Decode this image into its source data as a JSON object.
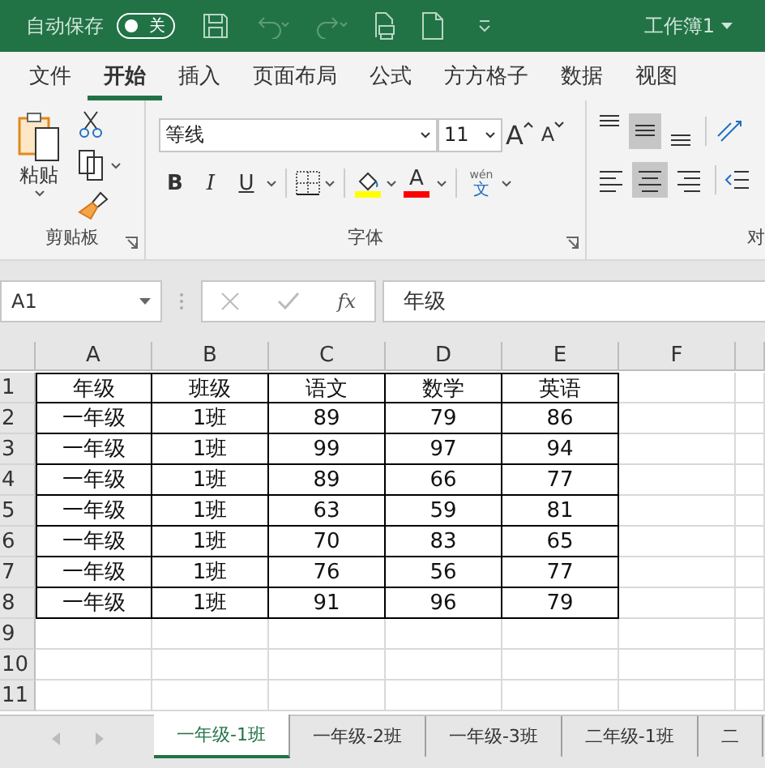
{
  "title_bar": {
    "autosave_label": "自动保存",
    "autosave_toggle": {
      "label": "关",
      "on": false
    },
    "workbook": "工作簿1"
  },
  "menu_tabs": [
    {
      "label": "文件",
      "selected": false
    },
    {
      "label": "开始",
      "selected": true
    },
    {
      "label": "插入",
      "selected": false
    },
    {
      "label": "页面布局",
      "selected": false
    },
    {
      "label": "公式",
      "selected": false
    },
    {
      "label": "方方格子",
      "selected": false
    },
    {
      "label": "数据",
      "selected": false
    },
    {
      "label": "视图",
      "selected": false
    }
  ],
  "ribbon": {
    "clipboard": {
      "label": "剪贴板",
      "paste": "粘贴"
    },
    "font": {
      "label": "字体",
      "name": "等线",
      "size": "11",
      "grow": "A",
      "shrink": "A",
      "bold": "B",
      "italic": "I",
      "underline": "U",
      "font_color": "A",
      "phonetic_top": "wén",
      "phonetic_bottom": "文"
    },
    "alignment": {
      "label": "对",
      "vertical": [
        {
          "selected": false
        },
        {
          "selected": true
        },
        {
          "selected": false
        }
      ],
      "horizontal": [
        {
          "selected": false
        },
        {
          "selected": true
        },
        {
          "selected": false
        }
      ]
    }
  },
  "formula_bar": {
    "name_box": "A1",
    "fx": "fx",
    "value": "年级"
  },
  "sheet": {
    "columns": [
      "A",
      "B",
      "C",
      "D",
      "E",
      "F"
    ],
    "rows": [
      {
        "header": "1",
        "cells": [
          "年级",
          "班级",
          "语文",
          "数学",
          "英语"
        ]
      },
      {
        "header": "2",
        "cells": [
          "一年级",
          "1班",
          "89",
          "79",
          "86"
        ]
      },
      {
        "header": "3",
        "cells": [
          "一年级",
          "1班",
          "99",
          "97",
          "94"
        ]
      },
      {
        "header": "4",
        "cells": [
          "一年级",
          "1班",
          "89",
          "66",
          "77"
        ]
      },
      {
        "header": "5",
        "cells": [
          "一年级",
          "1班",
          "63",
          "59",
          "81"
        ]
      },
      {
        "header": "6",
        "cells": [
          "一年级",
          "1班",
          "70",
          "83",
          "65"
        ]
      },
      {
        "header": "7",
        "cells": [
          "一年级",
          "1班",
          "76",
          "56",
          "77"
        ]
      },
      {
        "header": "8",
        "cells": [
          "一年级",
          "1班",
          "91",
          "96",
          "79"
        ]
      },
      {
        "header": "9"
      },
      {
        "header": "10"
      },
      {
        "header": "11"
      }
    ]
  },
  "sheet_tabs": [
    {
      "label": "一年级-1班",
      "selected": true
    },
    {
      "label": "一年级-2班",
      "selected": false
    },
    {
      "label": "一年级-3班",
      "selected": false
    },
    {
      "label": "二年级-1班",
      "selected": false
    },
    {
      "label": "二",
      "selected": false
    }
  ]
}
